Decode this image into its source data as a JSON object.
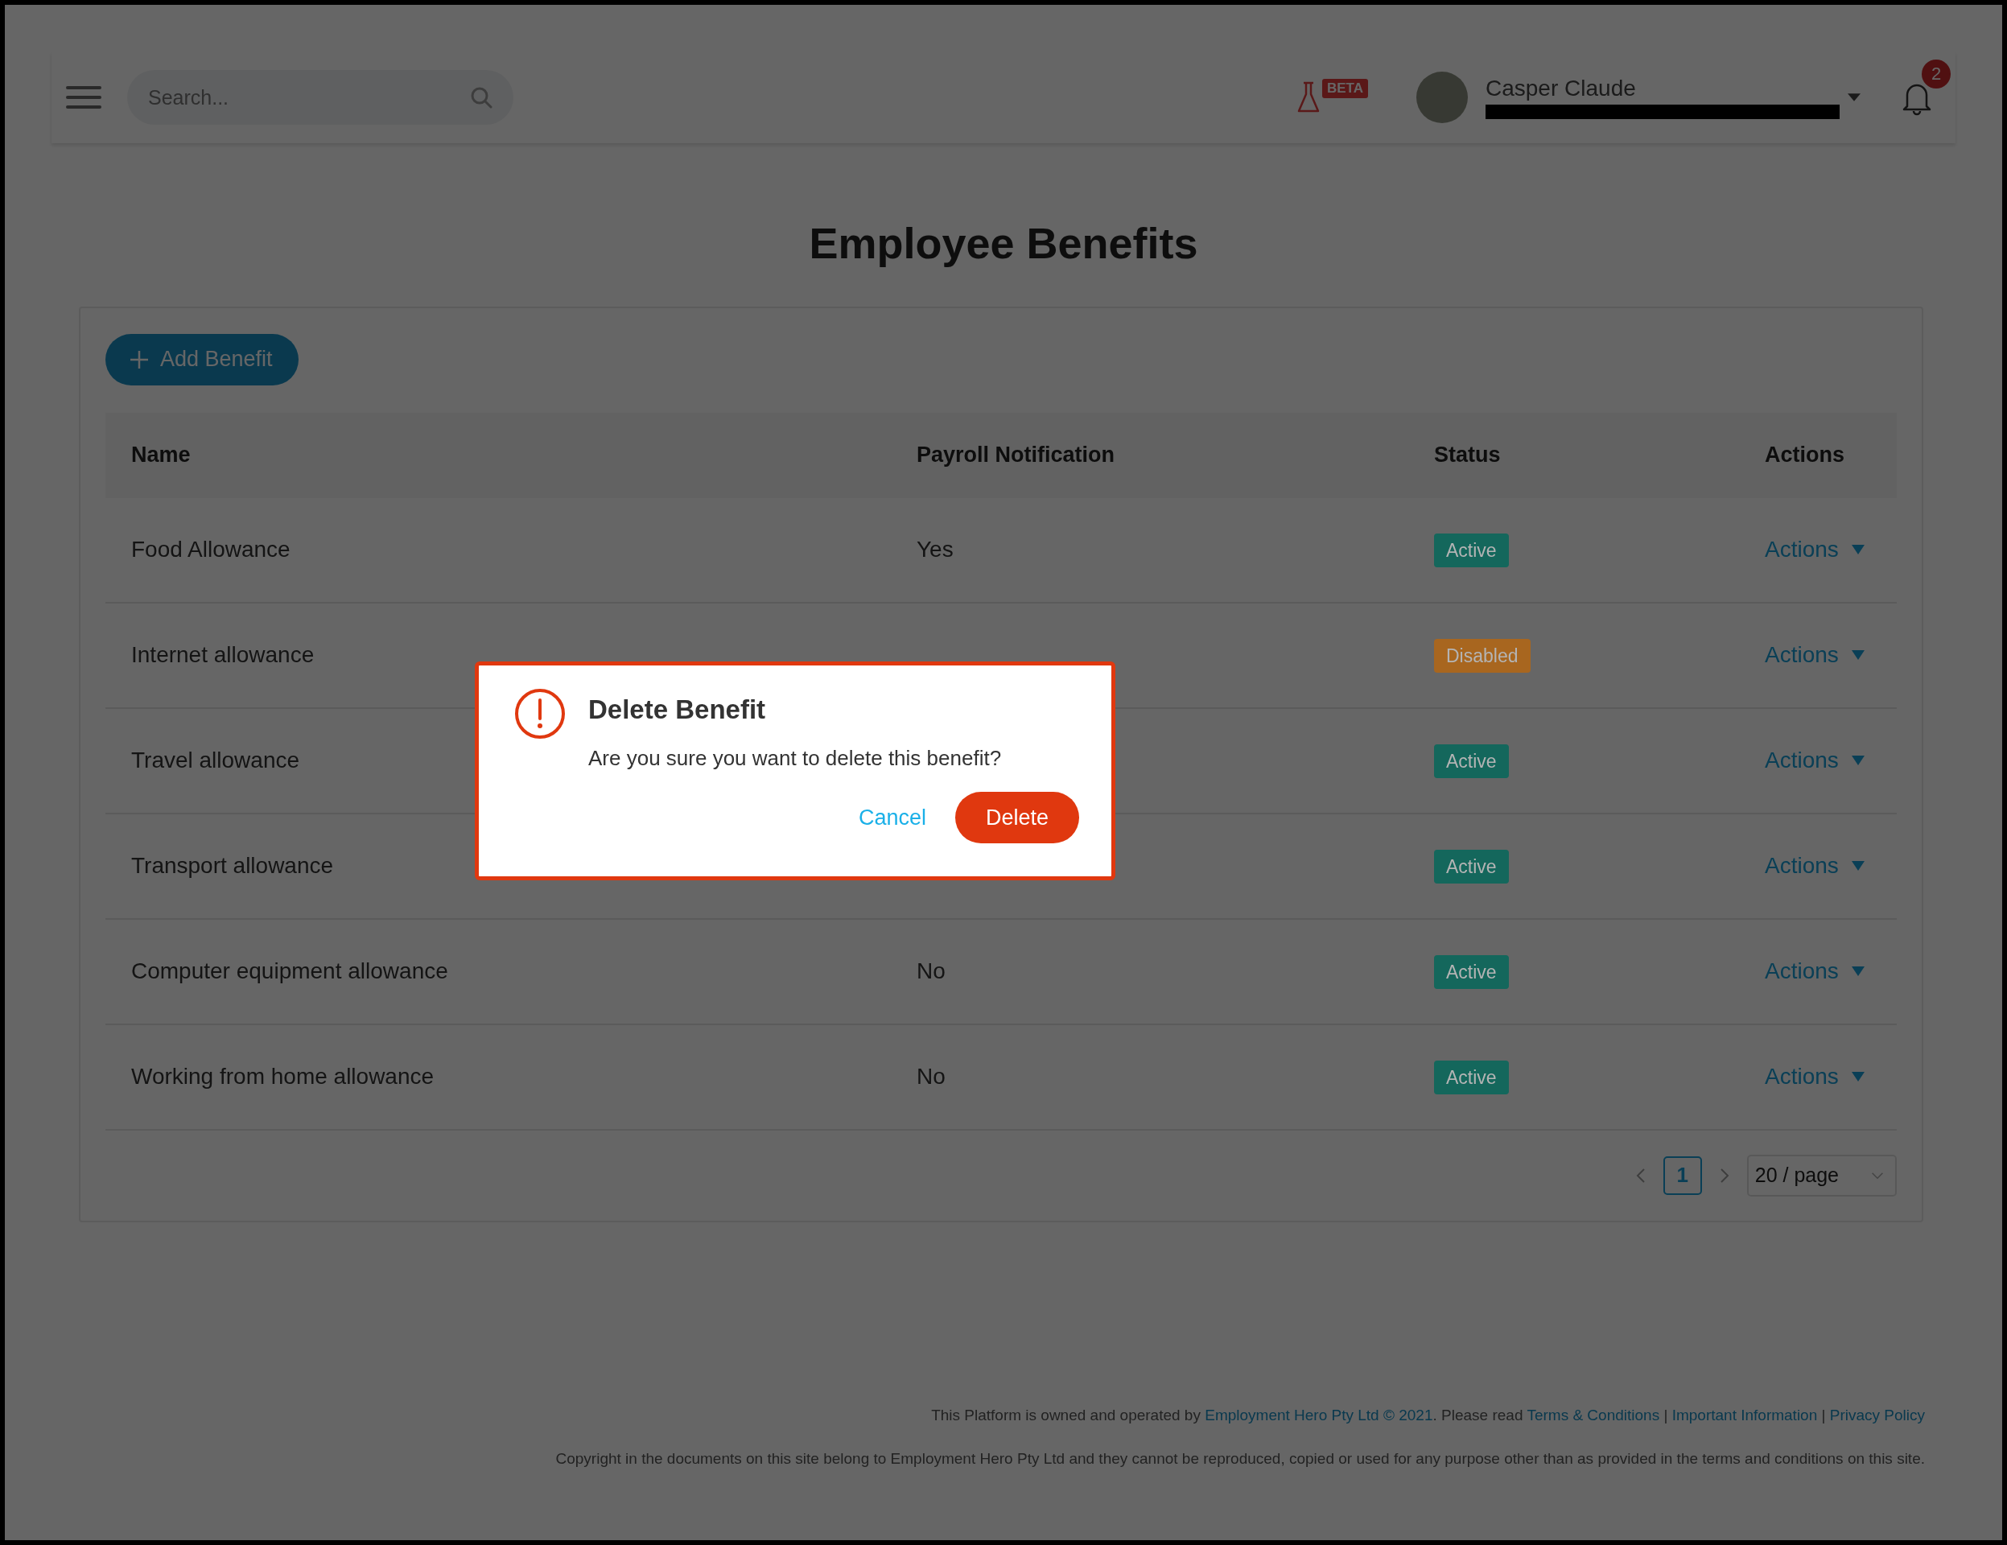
{
  "header": {
    "search": {
      "placeholder": "Search..."
    },
    "beta_badge": "BETA",
    "user": {
      "name": "Casper Claude"
    },
    "notifications": {
      "count": "2"
    }
  },
  "page_title": "Employee Benefits",
  "add_button": "Add Benefit",
  "table": {
    "columns": [
      "Name",
      "Payroll Notification",
      "Status",
      "Actions"
    ],
    "rows": [
      {
        "name": "Food Allowance",
        "payroll": "Yes",
        "status": "Active",
        "color": "#14675c",
        "action": "Actions"
      },
      {
        "name": "Internet allowance",
        "payroll": null,
        "status": "Disabled",
        "color": "#a8661f",
        "action": "Actions"
      },
      {
        "name": "Travel allowance",
        "payroll": null,
        "status": "Active",
        "color": "#14675c",
        "action": "Actions"
      },
      {
        "name": "Transport allowance",
        "payroll": null,
        "status": "Active",
        "color": "#14675c",
        "action": "Actions"
      },
      {
        "name": "Computer equipment allowance",
        "payroll": "No",
        "status": "Active",
        "color": "#14675c",
        "action": "Actions"
      },
      {
        "name": "Working from home allowance",
        "payroll": "No",
        "status": "Active",
        "color": "#14675c",
        "action": "Actions"
      }
    ]
  },
  "pagination": {
    "pages": [
      {
        "label": "1",
        "selected": true
      }
    ],
    "page_size": "20 / page"
  },
  "footer": {
    "line_1": [
      {
        "kind": "text",
        "text": "This Platform is owned and operated by "
      },
      {
        "kind": "link",
        "text": "Employment Hero Pty Ltd © 2021"
      },
      {
        "kind": "text",
        "text": ". Please read "
      },
      {
        "kind": "link",
        "text": "Terms & Conditions"
      },
      {
        "kind": "text",
        "text": " | "
      },
      {
        "kind": "link",
        "text": "Important Information"
      },
      {
        "kind": "text",
        "text": " | "
      },
      {
        "kind": "link",
        "text": "Privacy Policy"
      }
    ],
    "line_2": "Copyright in the documents on this site belong to Employment Hero Pty Ltd and they cannot be reproduced, copied or used for any purpose other than as provided in the terms and conditions on this site."
  },
  "dialog": {
    "title": "Delete Benefit",
    "message": "Are you sure you want to delete this benefit?",
    "cancel": "Cancel",
    "confirm": "Delete"
  }
}
